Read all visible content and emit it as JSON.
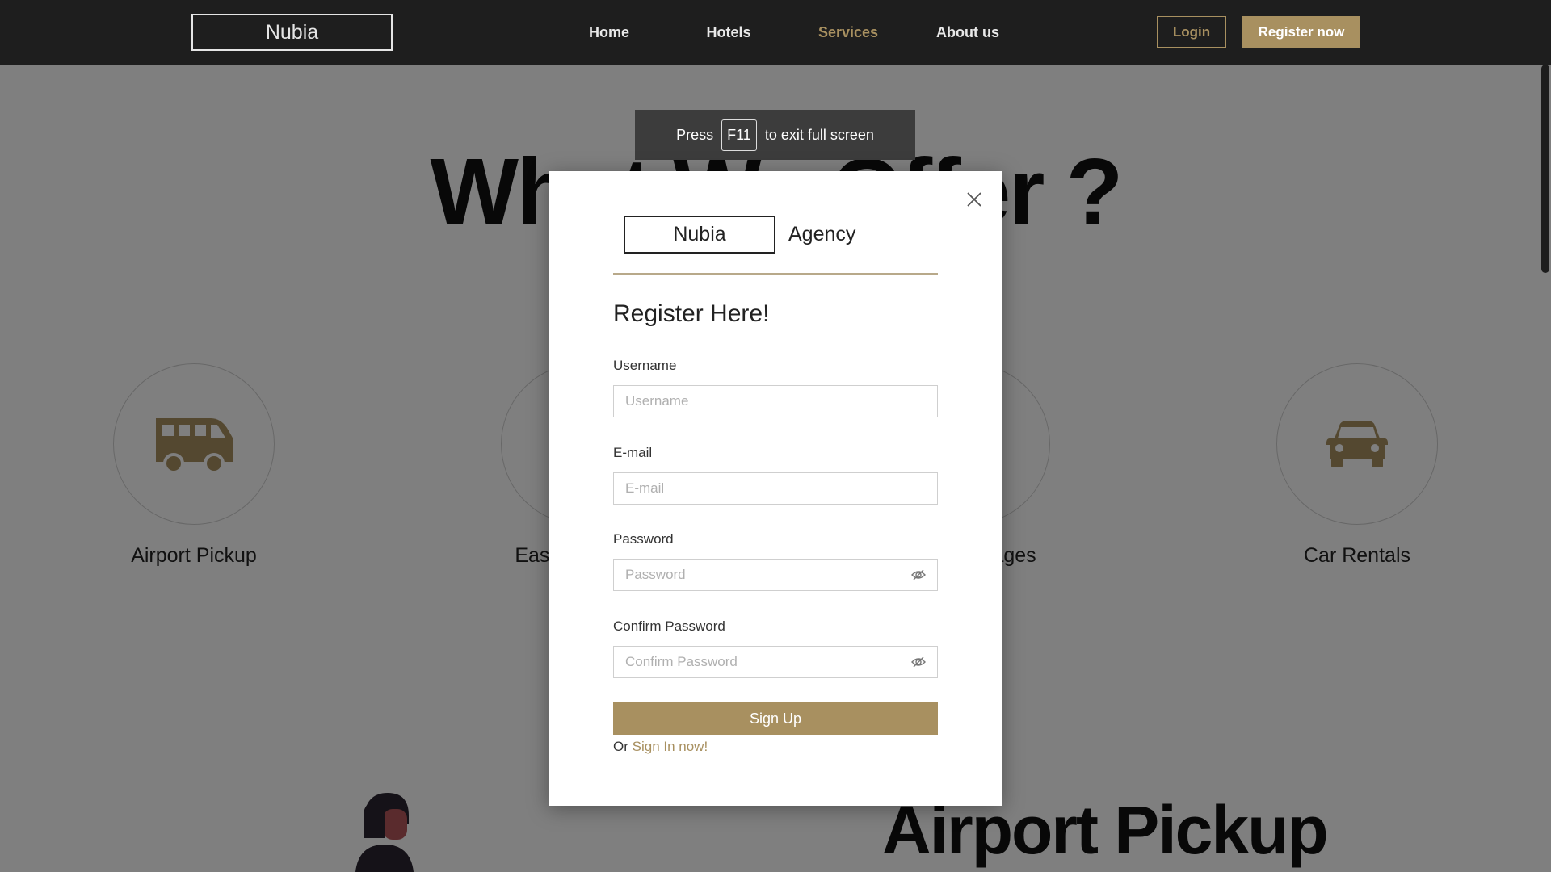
{
  "navbar": {
    "logo": "Nubia",
    "links": [
      "Home",
      "Hotels",
      "Services",
      "About us"
    ],
    "active_link": "Services",
    "login_label": "Login",
    "register_label": "Register now"
  },
  "page": {
    "heading": "What We Offer ?",
    "services": [
      {
        "label": "Airport Pickup",
        "icon": "van-icon"
      },
      {
        "label": "Easy Bookings",
        "icon": "booking-icon"
      },
      {
        "label": "Tour Packages",
        "icon": "package-icon"
      },
      {
        "label": "Car Rentals",
        "icon": "car-icon"
      }
    ],
    "section_heading": "Airport Pickup"
  },
  "fullscreen_notice": {
    "prefix": "Press",
    "key": "F11",
    "suffix": "to exit full screen"
  },
  "modal": {
    "brand_box": "Nubia",
    "brand_text": "Agency",
    "title": "Register Here!",
    "fields": [
      {
        "label": "Username",
        "placeholder": "Username",
        "type": "text"
      },
      {
        "label": "E-mail",
        "placeholder": "E-mail",
        "type": "email"
      },
      {
        "label": "Password",
        "placeholder": "Password",
        "type": "password"
      },
      {
        "label": "Confirm Password",
        "placeholder": "Confirm Password",
        "type": "password"
      }
    ],
    "submit_label": "Sign Up",
    "signin_prefix": "Or",
    "signin_link": "Sign In now!"
  },
  "colors": {
    "accent": "#a89060",
    "navbar_bg": "#1e1e1e",
    "overlay": "rgba(0,0,0,0.5)"
  }
}
